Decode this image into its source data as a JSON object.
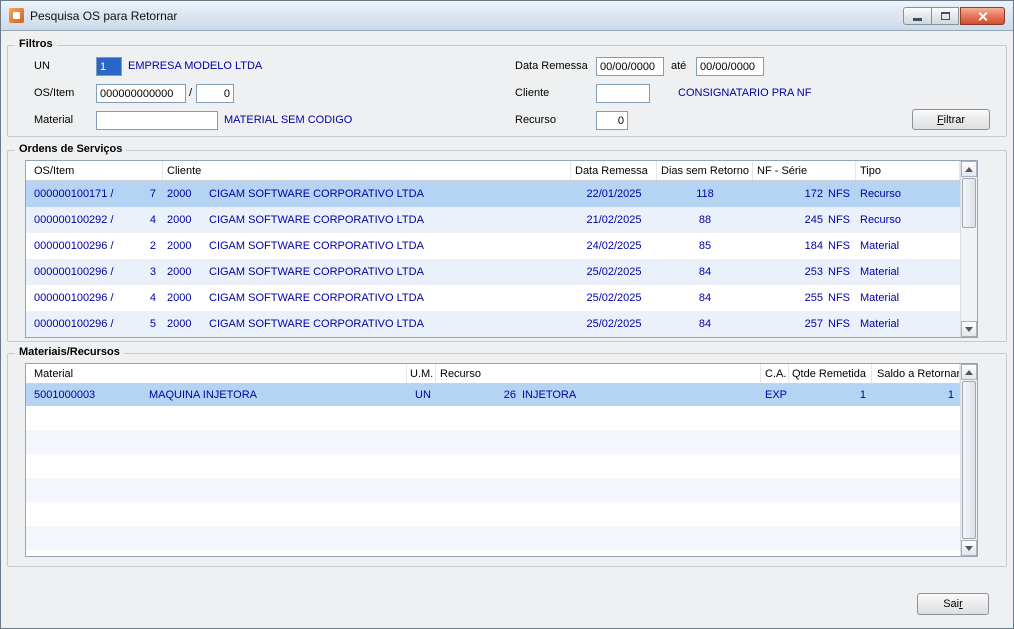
{
  "window": {
    "title": "Pesquisa OS para Retornar"
  },
  "filtros": {
    "title": "Filtros",
    "un": {
      "label": "UN",
      "value": "1",
      "desc": "EMPRESA MODELO LTDA"
    },
    "os_item": {
      "label": "OS/Item",
      "os_value": "000000000000",
      "separator": "/",
      "item_value": "0"
    },
    "material": {
      "label": "Material",
      "value": "",
      "desc": "MATERIAL SEM CODIGO"
    },
    "data_remessa": {
      "label": "Data Remessa",
      "from": "00/00/0000",
      "ate_label": "até",
      "to": "00/00/0000"
    },
    "cliente": {
      "label": "Cliente",
      "value": "",
      "desc": "CONSIGNATARIO PRA NF"
    },
    "recurso": {
      "label": "Recurso",
      "value": "0"
    },
    "filtrar_button": {
      "accel": "F",
      "rest": "iltrar"
    }
  },
  "ordens": {
    "title": "Ordens de Serviços",
    "headers": {
      "os_item": "OS/Item",
      "cliente": "Cliente",
      "data_remessa": "Data Remessa",
      "dias_sem_retorno": "Dias sem Retorno",
      "nf_serie": "NF - Série",
      "tipo": "Tipo"
    },
    "rows": [
      {
        "os": "000000100171 /",
        "item": "7",
        "cliente_cod": "2000",
        "cliente_nome": "CIGAM SOFTWARE CORPORATIVO LTDA",
        "data_remessa": "22/01/2025",
        "dias": "118",
        "nf": "172",
        "serie": "NFS",
        "tipo": "Recurso"
      },
      {
        "os": "000000100292 /",
        "item": "4",
        "cliente_cod": "2000",
        "cliente_nome": "CIGAM SOFTWARE CORPORATIVO LTDA",
        "data_remessa": "21/02/2025",
        "dias": "88",
        "nf": "245",
        "serie": "NFS",
        "tipo": "Recurso"
      },
      {
        "os": "000000100296 /",
        "item": "2",
        "cliente_cod": "2000",
        "cliente_nome": "CIGAM SOFTWARE CORPORATIVO LTDA",
        "data_remessa": "24/02/2025",
        "dias": "85",
        "nf": "184",
        "serie": "NFS",
        "tipo": "Material"
      },
      {
        "os": "000000100296 /",
        "item": "3",
        "cliente_cod": "2000",
        "cliente_nome": "CIGAM SOFTWARE CORPORATIVO LTDA",
        "data_remessa": "25/02/2025",
        "dias": "84",
        "nf": "253",
        "serie": "NFS",
        "tipo": "Material"
      },
      {
        "os": "000000100296 /",
        "item": "4",
        "cliente_cod": "2000",
        "cliente_nome": "CIGAM SOFTWARE CORPORATIVO LTDA",
        "data_remessa": "25/02/2025",
        "dias": "84",
        "nf": "255",
        "serie": "NFS",
        "tipo": "Material"
      },
      {
        "os": "000000100296 /",
        "item": "5",
        "cliente_cod": "2000",
        "cliente_nome": "CIGAM SOFTWARE CORPORATIVO LTDA",
        "data_remessa": "25/02/2025",
        "dias": "84",
        "nf": "257",
        "serie": "NFS",
        "tipo": "Material"
      }
    ]
  },
  "materiais": {
    "title": "Materiais/Recursos",
    "headers": {
      "material": "Material",
      "um": "U.M.",
      "recurso": "Recurso",
      "ca": "C.A.",
      "qtde_remetida": "Qtde Remetida",
      "saldo_a_retornar": "Saldo a Retornar"
    },
    "rows": [
      {
        "material": "5001000003",
        "descricao": "MAQUINA INJETORA",
        "um": "UN",
        "recurso_cod": "26",
        "recurso_nome": "INJETORA",
        "ca": "EXP",
        "qtde": "1",
        "saldo": "1"
      }
    ]
  },
  "footer": {
    "sair_button": {
      "pre": "Sai",
      "accel": "r"
    }
  }
}
